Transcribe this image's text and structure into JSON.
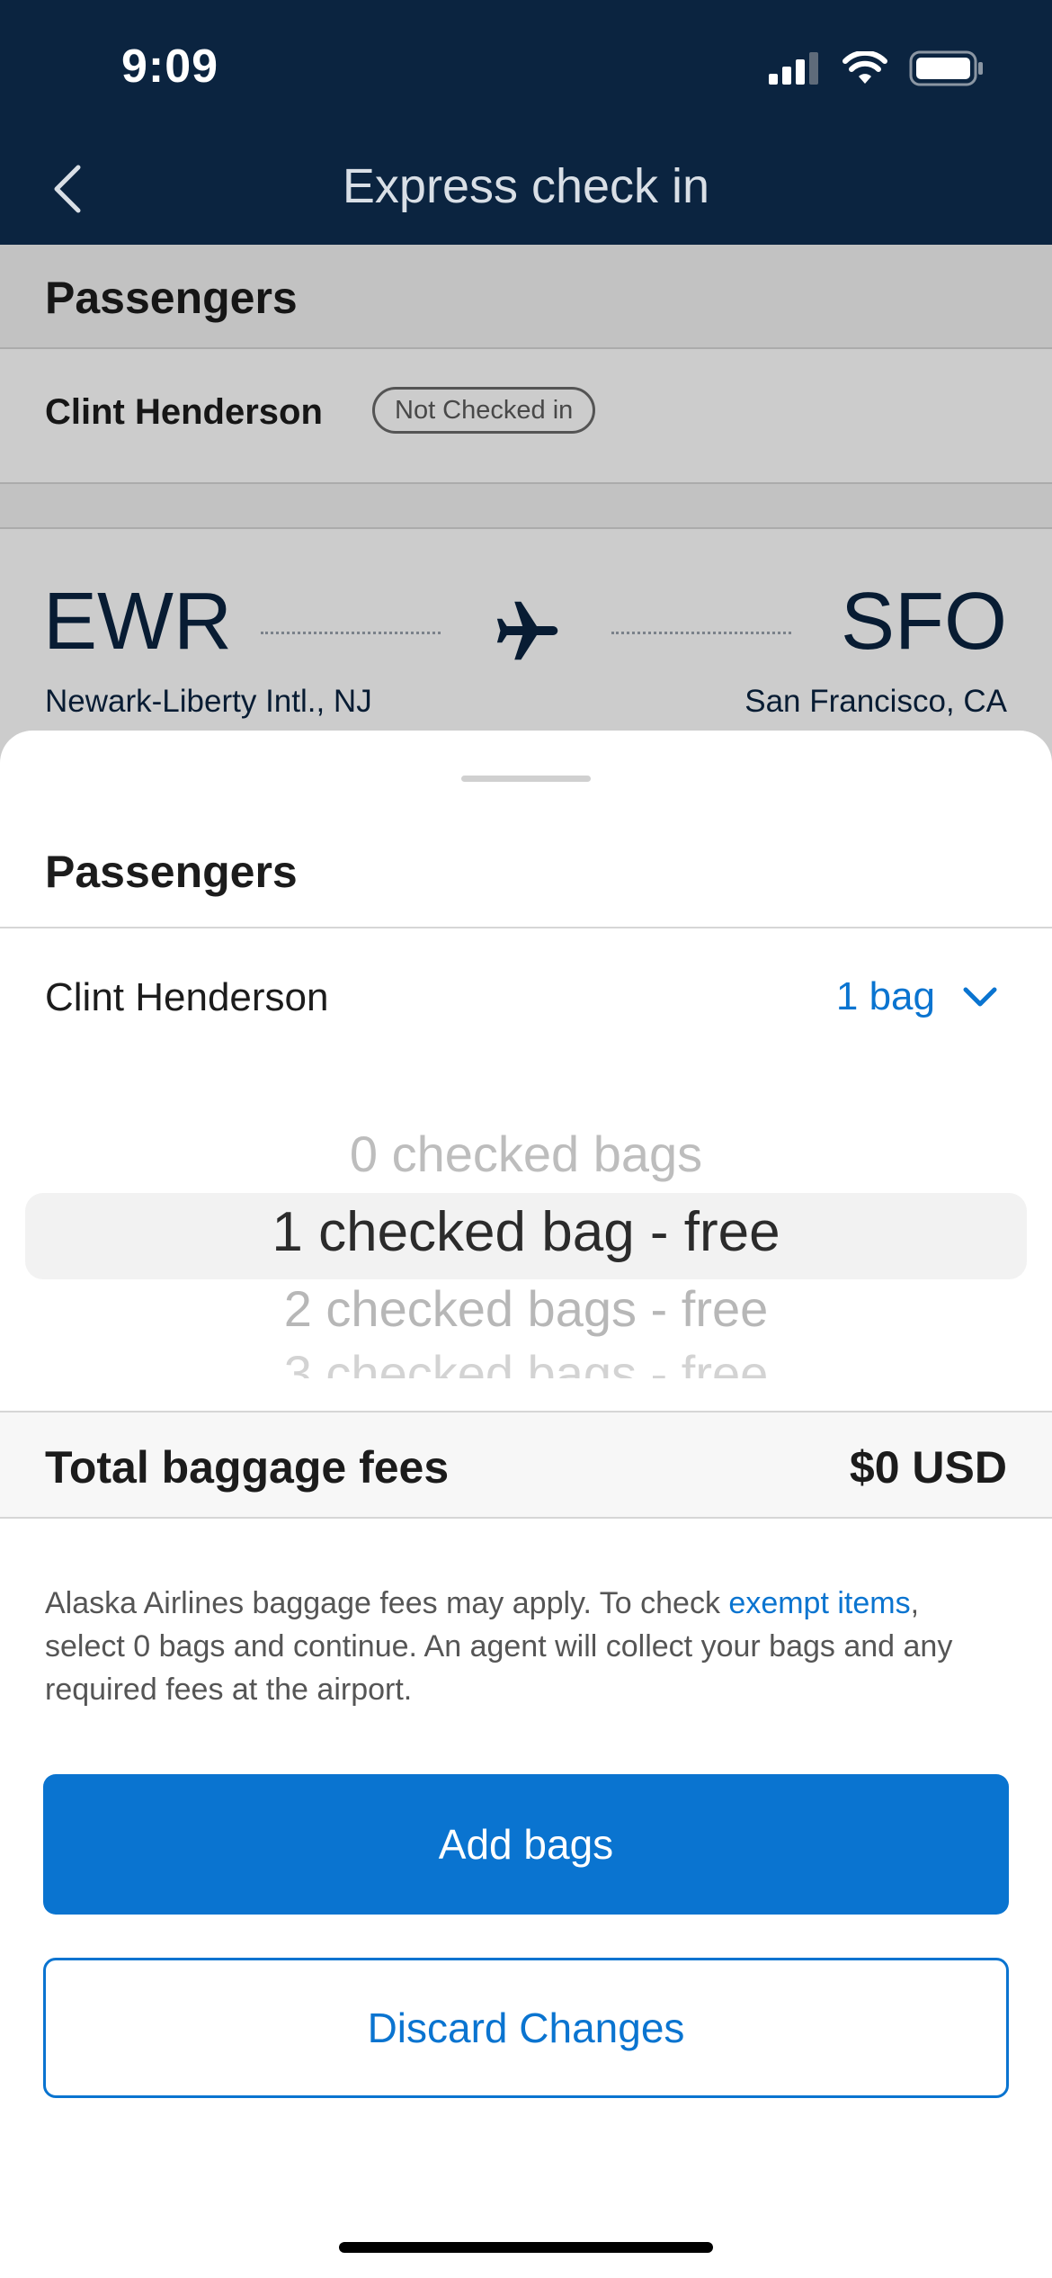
{
  "status_bar": {
    "time": "9:09",
    "icons": [
      "signal-icon",
      "wifi-icon",
      "battery-icon"
    ]
  },
  "nav": {
    "title": "Express check in",
    "back_icon": "chevron-left-icon"
  },
  "background": {
    "passengers_heading": "Passengers",
    "passenger_name": "Clint Henderson",
    "status_badge": "Not Checked in",
    "flight": {
      "origin_code": "EWR",
      "origin_city": "Newark-Liberty Intl., NJ",
      "destination_code": "SFO",
      "destination_city": "San Francisco, CA",
      "icon": "airplane-icon"
    }
  },
  "sheet": {
    "title": "Passengers",
    "passenger_name": "Clint Henderson",
    "bag_selection": "1 bag",
    "bag_selection_icon": "chevron-down-icon",
    "picker_options": [
      "0 checked bags",
      "1 checked bag - free",
      "2 checked bags - free",
      "3 checked bags - free"
    ],
    "selected_option": "1 checked bag - free",
    "fees_label": "Total baggage fees",
    "fees_value": "$0 USD",
    "notice_before": "Alaska Airlines baggage fees may apply. To check ",
    "notice_link": "exempt items",
    "notice_after": ", select 0 bags and continue. An agent will collect your bags and any required fees at the airport.",
    "add_button": "Add bags",
    "discard_button": "Discard Changes"
  },
  "colors": {
    "header_bg": "#0b2440",
    "accent": "#0a74d0",
    "text": "#1c1c1c"
  }
}
